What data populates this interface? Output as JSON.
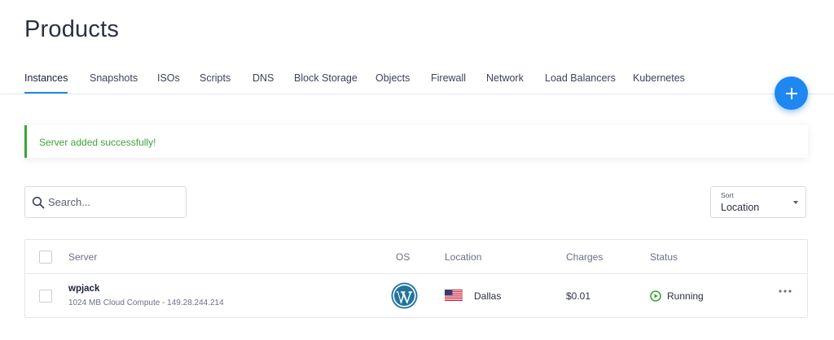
{
  "page": {
    "title": "Products"
  },
  "tabs": [
    {
      "label": "Instances",
      "active": true
    },
    {
      "label": "Snapshots"
    },
    {
      "label": "ISOs"
    },
    {
      "label": "Scripts"
    },
    {
      "label": "DNS"
    },
    {
      "label": "Block Storage"
    },
    {
      "label": "Objects"
    },
    {
      "label": "Firewall"
    },
    {
      "label": "Network"
    },
    {
      "label": "Load Balancers"
    },
    {
      "label": "Kubernetes"
    }
  ],
  "fab": {
    "icon": "plus-icon",
    "color": "#1e88f0"
  },
  "alert": {
    "message": "Server added successfully!",
    "color": "#3aa534"
  },
  "search": {
    "placeholder": "Search...",
    "value": "",
    "icon": "search-icon"
  },
  "sort": {
    "label": "Sort",
    "value": "Location"
  },
  "table": {
    "columns": [
      "Server",
      "OS",
      "Location",
      "Charges",
      "Status"
    ],
    "rows": [
      {
        "name": "wpjack",
        "meta": "1024 MB Cloud Compute - 149.28.244.214",
        "os": "wordpress-icon",
        "location_flag": "us-flag-icon",
        "location": "Dallas",
        "charges": "$0.01",
        "status": "Running",
        "status_color": "#3aa534"
      }
    ]
  },
  "colors": {
    "accent": "#1e88e5",
    "success": "#3aa534"
  }
}
